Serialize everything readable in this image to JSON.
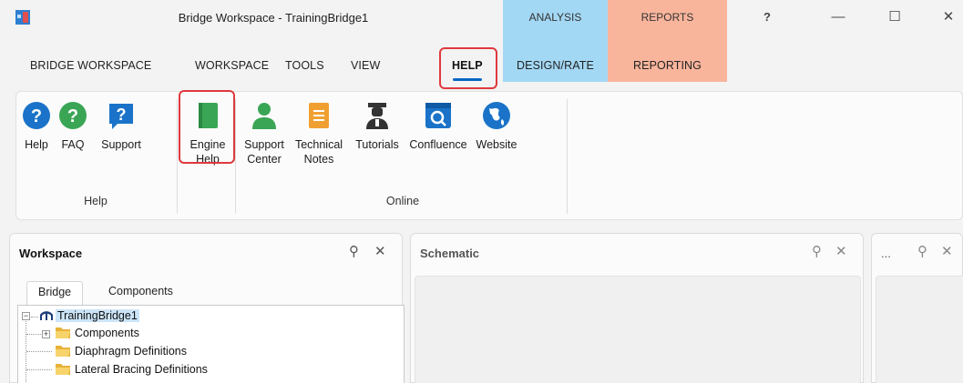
{
  "window": {
    "title": "Bridge Workspace - TrainingBridge1",
    "help_glyph": "?",
    "minimize_glyph": "—",
    "maximize_glyph": "☐",
    "close_glyph": "✕"
  },
  "context_groups": {
    "analysis": {
      "label": "ANALYSIS",
      "tab": "DESIGN/RATE",
      "color": "#a3d8f4"
    },
    "reports": {
      "label": "REPORTS",
      "tab": "REPORTING",
      "color": "#f9b59c"
    }
  },
  "menu_tabs": {
    "bridge_workspace": "BRIDGE WORKSPACE",
    "workspace": "WORKSPACE",
    "tools": "TOOLS",
    "view": "VIEW",
    "help": "HELP"
  },
  "ribbon": {
    "help_group": {
      "label": "Help",
      "buttons": {
        "help": "Help",
        "faq": "FAQ",
        "support": "Support"
      }
    },
    "engine_group": {
      "engine_help_line1": "Engine",
      "engine_help_line2": "Help"
    },
    "online_group": {
      "label": "Online",
      "support_center_line1": "Support",
      "support_center_line2": "Center",
      "technical_notes_line1": "Technical",
      "technical_notes_line2": "Notes",
      "tutorials": "Tutorials",
      "confluence": "Confluence",
      "website": "Website"
    }
  },
  "workspace_panel": {
    "title": "Workspace",
    "tabs": {
      "bridge": "Bridge",
      "components": "Components"
    },
    "tree": {
      "root": "TrainingBridge1",
      "items": [
        "Components",
        "Diaphragm Definitions",
        "Lateral Bracing Definitions"
      ]
    }
  },
  "schematic_panel": {
    "title": "Schematic"
  },
  "third_panel": {
    "title": "..."
  },
  "panel_glyphs": {
    "pin": "⚲",
    "close": "✕"
  },
  "colors": {
    "accent": "#0a66c2",
    "highlight": "#e0393e",
    "help_blue": "#1a73c8",
    "green": "#3aa655",
    "orange": "#f0a030"
  }
}
